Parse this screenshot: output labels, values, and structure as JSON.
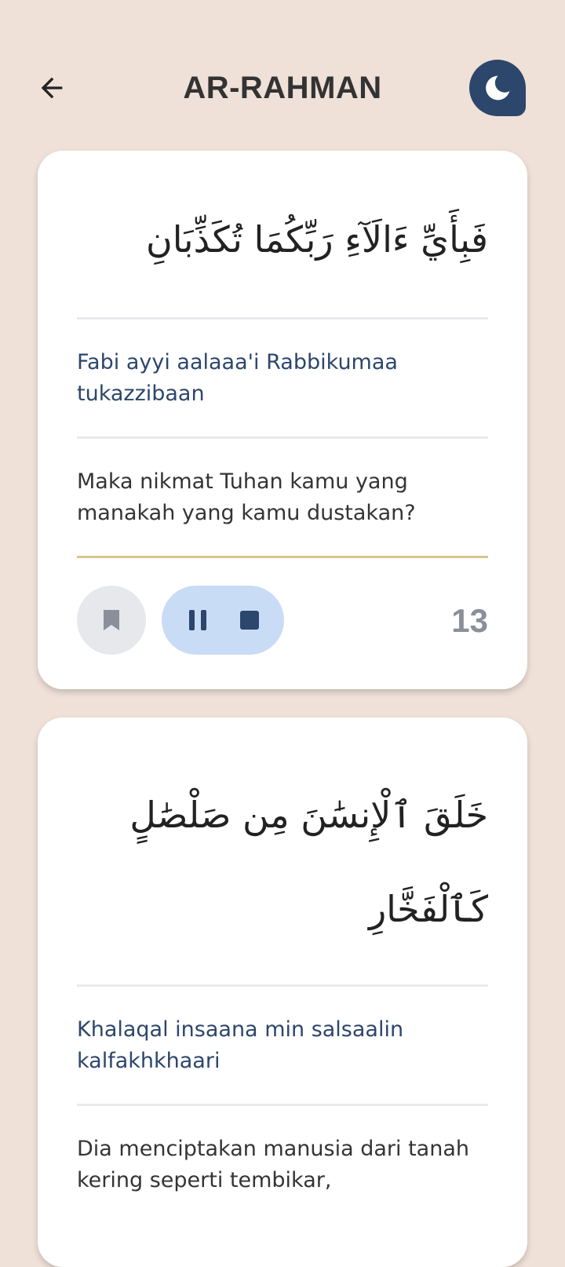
{
  "header": {
    "title": "AR-RAHMAN",
    "back_icon": "arrow-left-icon",
    "theme_icon": "moon-icon"
  },
  "colors": {
    "background": "#efe1d8",
    "accent_navy": "#2d466b",
    "player_bg": "#c9dcf5",
    "bookmark_bg": "#e6e8ec",
    "gold_divider": "#d8c58f"
  },
  "verses": [
    {
      "arabic": "فَبِأَيِّ ءَالَآءِ رَبِّكُمَا تُكَذِّبَانِ",
      "transliteration": "Fabi ayyi aalaaa'i Rabbikumaa tukazzibaan",
      "translation": "Maka nikmat Tuhan kamu yang manakah yang kamu dustakan?",
      "number": "13",
      "controls": {
        "bookmark_icon": "bookmark-icon",
        "pause_icon": "pause-icon",
        "stop_icon": "stop-icon"
      }
    },
    {
      "arabic": "خَلَقَ ٱلْإِنسَٰنَ مِن صَلْصَٰلٍ كَٱلْفَخَّارِ",
      "transliteration": "Khalaqal insaana min salsaalin kalfakhkhaari",
      "translation": "Dia menciptakan manusia dari tanah kering seperti tembikar,"
    }
  ]
}
